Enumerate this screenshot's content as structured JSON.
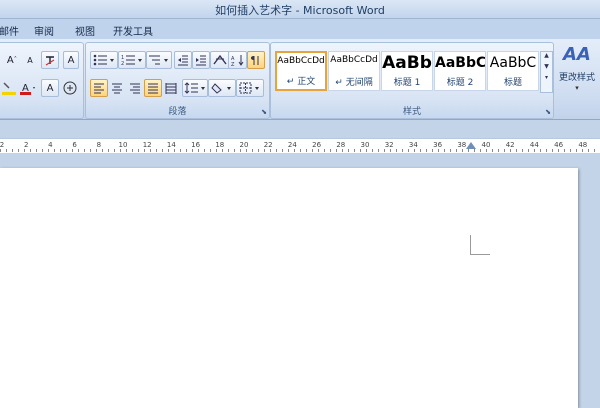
{
  "window": {
    "title": "如何插入艺术字 - Microsoft Word"
  },
  "tabs": [
    {
      "label": "邮件"
    },
    {
      "label": "审阅"
    },
    {
      "label": "视图"
    },
    {
      "label": "开发工具"
    }
  ],
  "groups": {
    "paragraph": {
      "label": "段落"
    },
    "styles": {
      "label": "样式"
    }
  },
  "styles_gallery": [
    {
      "sample": "AaBbCcDd",
      "name": "正文",
      "selected": true
    },
    {
      "sample": "AaBbCcDd",
      "name": "无间隔",
      "selected": false
    },
    {
      "sample": "AaBb",
      "name": "标题 1",
      "selected": false
    },
    {
      "sample": "AaBbC",
      "name": "标题 2",
      "selected": false
    },
    {
      "sample": "AaBbC",
      "name": "标题",
      "selected": false
    }
  ],
  "change_styles": {
    "label": "更改样式",
    "icon": "AA"
  },
  "ruler": {
    "ticks": [
      "2",
      "2",
      "4",
      "6",
      "8",
      "10",
      "12",
      "14",
      "16",
      "18",
      "20",
      "22",
      "24",
      "26",
      "28",
      "30",
      "32",
      "34",
      "36",
      "38",
      "40",
      "42",
      "44",
      "46",
      "48"
    ]
  },
  "colors": {
    "accent": "#e8a43c",
    "ribbon": "#dbe6f4",
    "font_color_red": "#d11a1a",
    "highlight_yellow": "#f4d400"
  }
}
